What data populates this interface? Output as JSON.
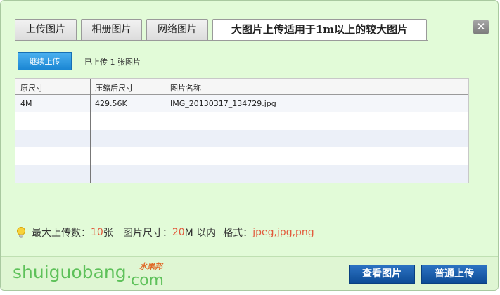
{
  "tabs": [
    {
      "label": "上传图片",
      "active": false
    },
    {
      "label": "相册图片",
      "active": false
    },
    {
      "label": "网络图片",
      "active": false
    },
    {
      "label": "大图片上传适用于1m以上的较大图片",
      "active": true
    }
  ],
  "close_icon": "close-icon",
  "toolbar": {
    "continue_label": "继续上传",
    "status_text": "已上传 1 张图片"
  },
  "table": {
    "columns": [
      "原尺寸",
      "压缩后尺寸",
      "图片名称"
    ],
    "rows": [
      {
        "original": "4M",
        "compressed": "429.56K",
        "name": "IMG_20130317_134729.jpg"
      }
    ]
  },
  "info": {
    "max_label": "最大上传数：",
    "max_count": "10",
    "max_unit": " 张",
    "size_label": "图片尺寸：",
    "size_value": "20",
    "size_unit": " M 以内",
    "format_label": "格式：",
    "format_value": "jpeg,jpg,png",
    "icon": "lightbulb-icon"
  },
  "logo": {
    "main": "shuiguobang.",
    "sub": "com",
    "cn": "水果邦"
  },
  "buttons": {
    "view_label": "查看图片",
    "upload_label": "普通上传"
  },
  "colors": {
    "dialog_bg": "#e2fbd8",
    "primary_button": "#1b86d3",
    "action_button": "#0d4c96",
    "highlight": "#e2583a",
    "logo_green": "#5ec15a"
  }
}
